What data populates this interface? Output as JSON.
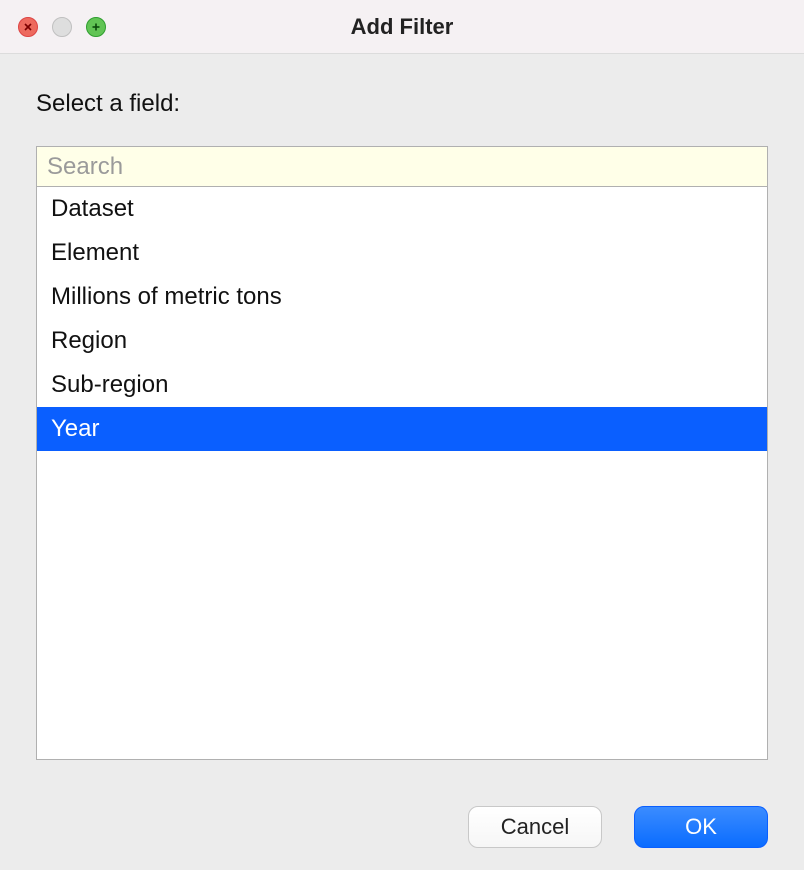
{
  "titlebar": {
    "title": "Add Filter"
  },
  "heading": "Select a field:",
  "search": {
    "placeholder": "Search",
    "value": ""
  },
  "fields": [
    {
      "label": "Dataset",
      "selected": false
    },
    {
      "label": "Element",
      "selected": false
    },
    {
      "label": "Millions of metric tons",
      "selected": false
    },
    {
      "label": "Region",
      "selected": false
    },
    {
      "label": "Sub-region",
      "selected": false
    },
    {
      "label": "Year",
      "selected": true
    }
  ],
  "buttons": {
    "cancel": "Cancel",
    "ok": "OK"
  }
}
